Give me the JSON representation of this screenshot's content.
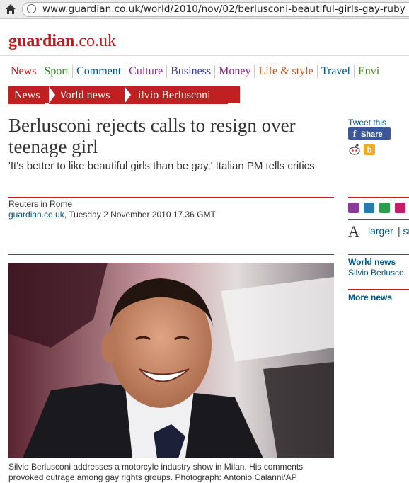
{
  "browser": {
    "url": "www.guardian.co.uk/world/2010/nov/02/berlusconi-beautiful-girls-gay-ruby"
  },
  "logo": {
    "main": "guardian",
    "suffix": ".co.uk"
  },
  "nav": {
    "items": [
      {
        "label": "News",
        "color": "#b41e1e"
      },
      {
        "label": "Sport",
        "color": "#2e8b1e"
      },
      {
        "label": "Comment",
        "color": "#005689"
      },
      {
        "label": "Culture",
        "color": "#9b2a9b"
      },
      {
        "label": "Business",
        "color": "#3b3b9b"
      },
      {
        "label": "Money",
        "color": "#8b1e8b"
      },
      {
        "label": "Life & style",
        "color": "#c0561e"
      },
      {
        "label": "Travel",
        "color": "#005689"
      },
      {
        "label": "Envi",
        "color": "#4b8b1e"
      }
    ]
  },
  "breadcrumb": {
    "news": "News",
    "world": "World news",
    "person": "Silvio Berlusconi"
  },
  "article": {
    "headline": "Berlusconi rejects calls to resign over teenage girl",
    "standfirst": "'It's better to like beautiful girls than be gay,' Italian PM tells critics",
    "byline": "Reuters in Rome",
    "source": "guardian.co.uk",
    "date": ", Tuesday 2 November 2010 17.36 GMT",
    "caption": "Silvio Berlusconi addresses a motorcyle industry show in Milan. His comments provoked outrage among gay rights groups. Photograph: Antonio Calanni/AP"
  },
  "sidebar": {
    "tweet": "Tweet this",
    "share": "Share",
    "text_larger": "larger",
    "text_smaller": "| sm",
    "font_icon": "A",
    "world_news": "World news",
    "berlusconi_link": "Silvio Berlusco",
    "more_news": "More news"
  },
  "colors": {
    "brand": "#b41e1e",
    "link": "#005689"
  }
}
